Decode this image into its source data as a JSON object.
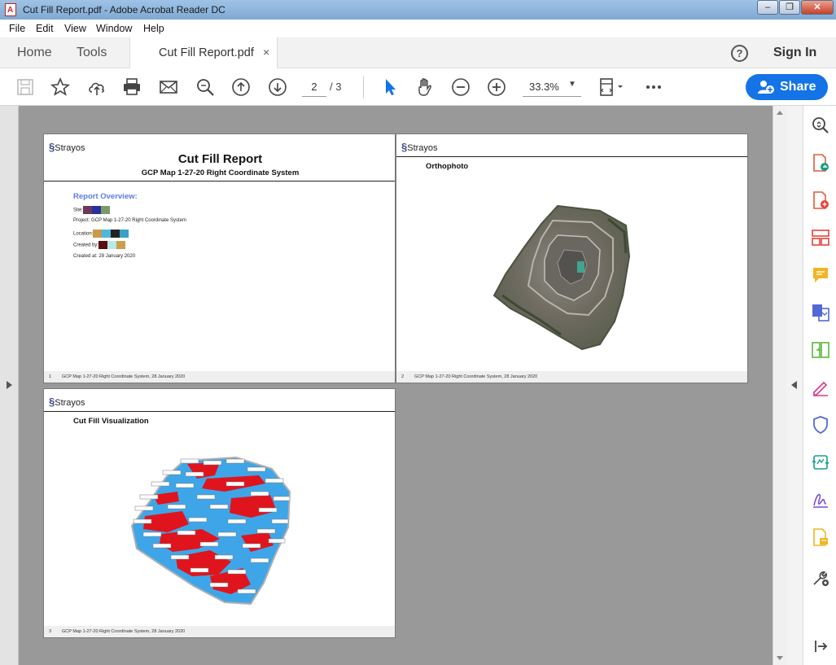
{
  "window": {
    "title": "Cut Fill Report.pdf - Adobe Acrobat Reader DC",
    "buttons": [
      "–",
      "❐",
      "✕"
    ]
  },
  "menu": [
    "File",
    "Edit",
    "View",
    "Window",
    "Help"
  ],
  "tabs": {
    "home": "Home",
    "tools": "Tools",
    "document": "Cut Fill Report.pdf",
    "close": "×"
  },
  "header": {
    "sign_in": "Sign In",
    "help": "?"
  },
  "toolbar": {
    "current_page": "2",
    "total_pages": "/ 3",
    "zoom": "33.3%",
    "share_label": "Share"
  },
  "pages": [
    {
      "logo": "Strayos",
      "title": "Cut Fill Report",
      "subtitle": "GCP Map 1-27-20 Right Coordinate System",
      "overview_heading": "Report Overview:",
      "site_label": "Site:",
      "project_line": "Project: GCP Map 1-27-20 Right Coordinate System",
      "location_label": "Location:",
      "created_by_label": "Created by:",
      "created_at_line": "Created at: 28 January 2020",
      "swatches": {
        "site": [
          "#6b3a5a",
          "#2a2f9e",
          "#7a9a6a"
        ],
        "location": [
          "#c89a4a",
          "#4fb6dc",
          "#222222",
          "#3aa0c8"
        ],
        "created_by": [
          "#5a1010",
          "#b8e8e8",
          "#c8a050"
        ]
      },
      "footer_num": "1",
      "footer_text": "GCP Map 1-27-20 Right Coordinate System, 28 January 2020"
    },
    {
      "logo": "Strayos",
      "section": "Orthophoto",
      "footer_num": "2",
      "footer_text": "GCP Map 1-27-20 Right Coordinate System, 28 January 2020"
    },
    {
      "logo": "Strayos",
      "section": "Cut Fill Visualization",
      "footer_num": "3",
      "footer_text": "GCP Map 1-27-20 Right Coordinate System, 28 January 2020"
    }
  ],
  "colors": {
    "accent": "#1473e6",
    "viewer_bg": "#999999",
    "cut": "#e0141c",
    "fill": "#3ea6e8",
    "overview_heading": "#5b7be2"
  },
  "icons": {
    "toolbar": [
      "save-icon",
      "bookmark-star-icon",
      "upload-cloud-icon",
      "print-icon",
      "email-icon",
      "search-zoom-icon",
      "page-up-icon",
      "page-down-icon",
      "select-cursor-icon",
      "hand-tool-icon",
      "zoom-out-icon",
      "zoom-in-icon",
      "fit-page-icon",
      "more-icon"
    ],
    "sidebar": [
      "zoom-search-icon",
      "export-pdf-icon",
      "create-pdf-icon",
      "organize-pages-icon",
      "comment-icon",
      "combine-files-icon",
      "compress-icon",
      "fill-sign-icon",
      "protect-icon",
      "send-track-icon",
      "signature-icon",
      "edit-notes-icon",
      "more-tools-icon",
      "collapse-panel-icon"
    ]
  }
}
